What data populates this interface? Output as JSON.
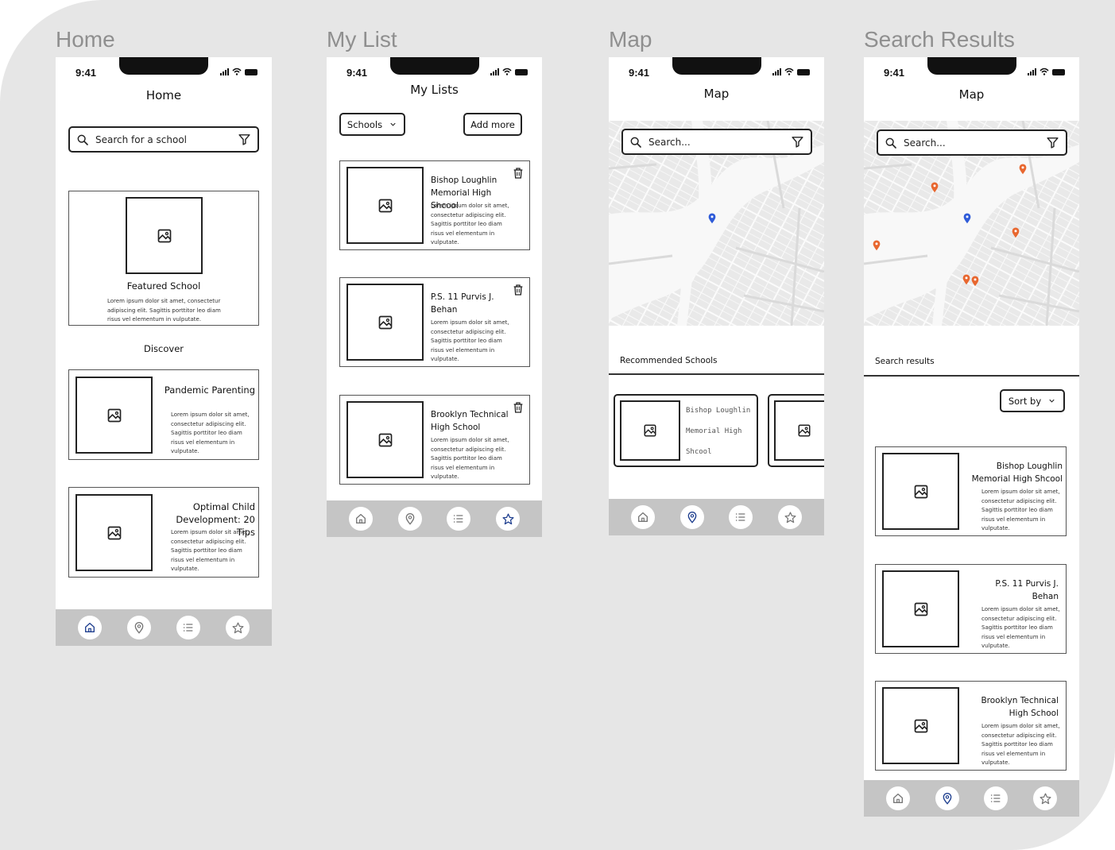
{
  "frames": {
    "home": "Home",
    "my_list": "My List",
    "map": "Map",
    "search_results": "Search Results"
  },
  "status_time": "9:41",
  "home": {
    "title": "Home",
    "search_placeholder": "Search for a school",
    "featured_title": "Featured School",
    "featured_text": "Lorem ipsum dolor sit amet, consectetur adipiscing elit. Sagittis porttitor leo diam risus vel elementum in vulputate.",
    "discover_label": "Discover",
    "cards": [
      {
        "title": "Pandemic Parenting",
        "text": "Lorem ipsum dolor sit amet, consectetur adipiscing elit. Sagittis porttitor leo diam risus vel elementum in vulputate."
      },
      {
        "title": "Optimal Child Development: 20 Tips",
        "text": "Lorem ipsum dolor sit amet, consectetur adipiscing elit. Sagittis porttitor leo diam risus vel elementum in vulputate."
      }
    ]
  },
  "my_list": {
    "title": "My Lists",
    "dropdown": "Schools",
    "add_more": "Add more",
    "items": [
      {
        "title": "Bishop Loughlin Memorial High Shcool",
        "text": "Lorem ipsum dolor sit amet, consectetur adipiscing elit. Sagittis porttitor leo diam risus vel elementum in vulputate."
      },
      {
        "title": "P.S. 11 Purvis J. Behan",
        "text": "Lorem ipsum dolor sit amet, consectetur adipiscing elit. Sagittis porttitor leo diam risus vel elementum in vulputate."
      },
      {
        "title": "Brooklyn Technical High School",
        "text": "Lorem ipsum dolor sit amet, consectetur adipiscing elit. Sagittis porttitor leo diam risus vel elementum in vulputate."
      }
    ]
  },
  "map": {
    "title": "Map",
    "search_placeholder": "Search...",
    "recommended_label": "Recommended Schools",
    "rec_card": [
      "Bishop Loughlin",
      "Memorial High",
      "Shcool"
    ]
  },
  "search_results": {
    "title": "Map",
    "search_placeholder": "Search...",
    "results_label": "Search results",
    "sort_by": "Sort by",
    "items": [
      {
        "title": "Bishop Loughlin Memorial High Shcool",
        "text": "Lorem ipsum dolor sit amet, consectetur adipiscing elit. Sagittis porttitor leo diam risus vel elementum in vulputate."
      },
      {
        "title": "P.S. 11 Purvis J. Behan",
        "text": "Lorem ipsum dolor sit amet, consectetur adipiscing elit. Sagittis porttitor leo diam risus vel elementum in vulputate."
      },
      {
        "title": "Brooklyn Technical High School",
        "text": "Lorem ipsum dolor sit amet, consectetur adipiscing elit. Sagittis porttitor leo diam risus vel elementum in vulputate."
      }
    ]
  },
  "nav_items": [
    "home-icon",
    "map-pin-icon",
    "list-icon",
    "star-icon"
  ],
  "colors": {
    "nav_bg": "#c5c5c5",
    "pin_blue": "#2f5bd8",
    "pin_orange": "#e8672f",
    "active_icon": "#1f3f8f"
  }
}
